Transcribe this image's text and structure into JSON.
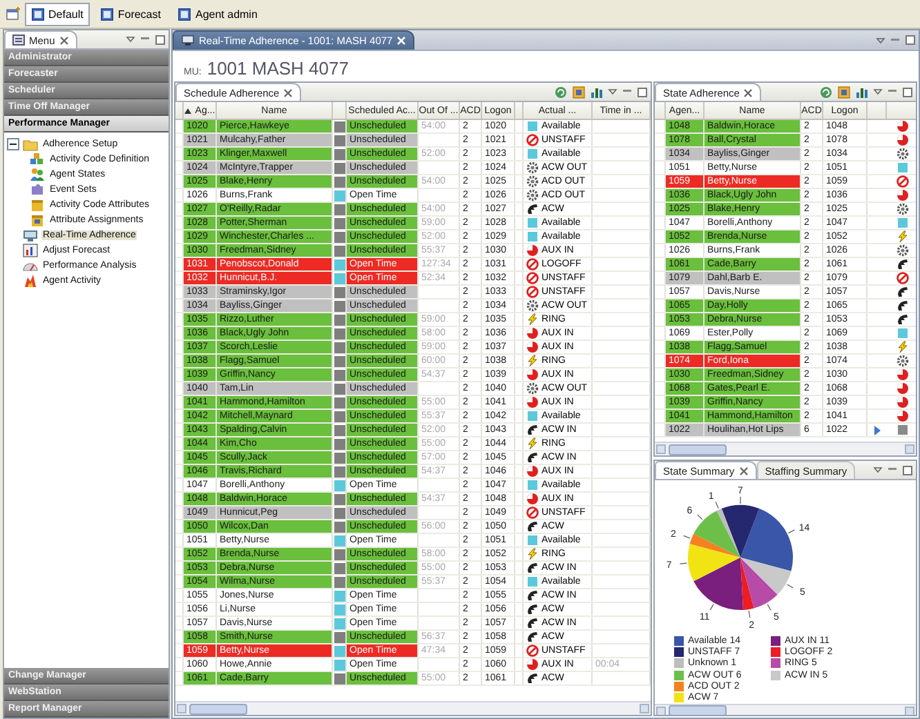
{
  "toolbar": {
    "perspectives": [
      {
        "label": "Default",
        "selected": true
      },
      {
        "label": "Forecast",
        "selected": false
      },
      {
        "label": "Agent admin",
        "selected": false
      }
    ]
  },
  "menu": {
    "title": "Menu",
    "sections_top": [
      {
        "label": "Administrator",
        "expanded": false
      },
      {
        "label": "Forecaster",
        "expanded": false
      },
      {
        "label": "Scheduler",
        "expanded": false
      },
      {
        "label": "Time Off Manager",
        "expanded": false
      },
      {
        "label": "Performance Manager",
        "expanded": true
      }
    ],
    "tree": [
      {
        "label": "Adherence Setup",
        "expanded": true,
        "selected": false,
        "children": [
          {
            "label": "Activity Code Definition",
            "selected": false
          },
          {
            "label": "Agent States",
            "selected": false
          },
          {
            "label": "Event Sets",
            "selected": false
          },
          {
            "label": "Activity Code Attributes",
            "selected": false
          },
          {
            "label": "Attribute Assignments",
            "selected": false
          }
        ]
      },
      {
        "label": "Real-Time Adherence",
        "selected": true
      },
      {
        "label": "Adjust Forecast",
        "selected": false
      },
      {
        "label": "Performance Analysis",
        "selected": false
      },
      {
        "label": "Agent Activity",
        "selected": false
      }
    ],
    "sections_bottom": [
      {
        "label": "Change Manager",
        "expanded": false
      },
      {
        "label": "WebStation",
        "expanded": false
      },
      {
        "label": "Report Manager",
        "expanded": false
      }
    ]
  },
  "editor": {
    "tab": "Real-Time Adherence - 1001: MASH 4077",
    "mu_label": "MU:",
    "mu_value": "1001 MASH 4077"
  },
  "schedule_adherence": {
    "title": "Schedule Adherence",
    "columns": [
      {
        "label": "Ag...",
        "sorted": true
      },
      {
        "label": "Name",
        "sorted": false
      },
      {
        "label": "Scheduled Ac...",
        "sorted": false
      },
      {
        "label": "Out Of ...",
        "sorted": false
      },
      {
        "label": "ACD",
        "sorted": false
      },
      {
        "label": "Logon",
        "sorted": false
      },
      {
        "label": "Actual ...",
        "sorted": false
      },
      {
        "label": "Time in ...",
        "sorted": false
      }
    ],
    "rows": [
      {
        "agent": "1020",
        "name": "Pierce,Hawkeye",
        "color": "#6abf3c",
        "swatch": {
          "color": "#7f7f7f"
        },
        "activity": "Unscheduled",
        "out_of": "54:00",
        "acd": "2",
        "logon": "1020",
        "state": {
          "kind": "available",
          "label": "Available"
        }
      },
      {
        "agent": "1021",
        "name": "Mulcahy,Father",
        "color": "#c0c0c0",
        "swatch": {
          "color": "#7f7f7f"
        },
        "activity": "Unscheduled",
        "acd": "2",
        "logon": "1021",
        "state": {
          "kind": "no_entry",
          "label": "UNSTAFF"
        }
      },
      {
        "agent": "1023",
        "name": "Klinger,Maxwell",
        "color": "#6abf3c",
        "swatch": {
          "color": "#7f7f7f"
        },
        "activity": "Unscheduled",
        "out_of": "52:00",
        "acd": "2",
        "logon": "1023",
        "state": {
          "kind": "available",
          "label": "Available"
        }
      },
      {
        "agent": "1024",
        "name": "McIntyre,Trapper",
        "color": "#c0c0c0",
        "swatch": {
          "color": "#7f7f7f"
        },
        "activity": "Unscheduled",
        "acd": "2",
        "logon": "1024",
        "state": {
          "kind": "gear",
          "label": "ACW OUT"
        }
      },
      {
        "agent": "1025",
        "name": "Blake,Henry",
        "color": "#6abf3c",
        "swatch": {
          "color": "#7f7f7f"
        },
        "activity": "Unscheduled",
        "out_of": "54:00",
        "acd": "2",
        "logon": "1025",
        "state": {
          "kind": "gear",
          "label": "ACD OUT"
        }
      },
      {
        "agent": "1026",
        "name": "Burns,Frank",
        "color": "#ffffff",
        "swatch": {
          "color": "#5cc8dc"
        },
        "activity": "Open Time",
        "acd": "2",
        "logon": "1026",
        "state": {
          "kind": "gear",
          "label": "ACD OUT"
        }
      },
      {
        "agent": "1027",
        "name": "O'Reilly,Radar",
        "color": "#6abf3c",
        "swatch": {
          "color": "#7f7f7f"
        },
        "activity": "Unscheduled",
        "out_of": "54:00",
        "acd": "2",
        "logon": "1027",
        "state": {
          "kind": "hand",
          "label": "ACW"
        }
      },
      {
        "agent": "1028",
        "name": "Potter,Sherman",
        "color": "#6abf3c",
        "swatch": {
          "color": "#7f7f7f"
        },
        "activity": "Unscheduled",
        "out_of": "59:00",
        "acd": "2",
        "logon": "1028",
        "state": {
          "kind": "available",
          "label": "Available"
        }
      },
      {
        "agent": "1029",
        "name": "Winchester,Charles ...",
        "color": "#6abf3c",
        "swatch": {
          "color": "#7f7f7f"
        },
        "activity": "Unscheduled",
        "out_of": "52:00",
        "acd": "2",
        "logon": "1029",
        "state": {
          "kind": "available",
          "label": "Available"
        }
      },
      {
        "agent": "1030",
        "name": "Freedman,Sidney",
        "color": "#6abf3c",
        "swatch": {
          "color": "#7f7f7f"
        },
        "activity": "Unscheduled",
        "out_of": "55:37",
        "acd": "2",
        "logon": "1030",
        "state": {
          "kind": "pie",
          "label": "AUX IN"
        }
      },
      {
        "agent": "1031",
        "name": "Penobscot,Donald",
        "color": "#ee2a24",
        "swatch": {
          "color": "#5cc8dc"
        },
        "activity": "Open Time",
        "out_of": "127:34",
        "acd": "2",
        "logon": "1031",
        "state": {
          "kind": "no_entry",
          "label": "LOGOFF"
        }
      },
      {
        "agent": "1032",
        "name": "Hunnicut,B.J.",
        "color": "#ee2a24",
        "swatch": {
          "color": "#5cc8dc"
        },
        "activity": "Open Time",
        "out_of": "52:34",
        "acd": "2",
        "logon": "1032",
        "state": {
          "kind": "no_entry",
          "label": "UNSTAFF"
        }
      },
      {
        "agent": "1033",
        "name": "Straminsky,Igor",
        "color": "#c0c0c0",
        "swatch": {
          "color": "#7f7f7f"
        },
        "activity": "Unscheduled",
        "acd": "2",
        "logon": "1033",
        "state": {
          "kind": "no_entry",
          "label": "UNSTAFF"
        }
      },
      {
        "agent": "1034",
        "name": "Bayliss,Ginger",
        "color": "#c0c0c0",
        "swatch": {
          "color": "#7f7f7f"
        },
        "activity": "Unscheduled",
        "acd": "2",
        "logon": "1034",
        "state": {
          "kind": "gear",
          "label": "ACW OUT"
        }
      },
      {
        "agent": "1035",
        "name": "Rizzo,Luther",
        "color": "#6abf3c",
        "swatch": {
          "color": "#7f7f7f"
        },
        "activity": "Unscheduled",
        "out_of": "59:00",
        "acd": "2",
        "logon": "1035",
        "state": {
          "kind": "lightning",
          "label": "RING"
        }
      },
      {
        "agent": "1036",
        "name": "Black,Ugly John",
        "color": "#6abf3c",
        "swatch": {
          "color": "#7f7f7f"
        },
        "activity": "Unscheduled",
        "out_of": "58:00",
        "acd": "2",
        "logon": "1036",
        "state": {
          "kind": "pie",
          "label": "AUX IN"
        }
      },
      {
        "agent": "1037",
        "name": "Scorch,Leslie",
        "color": "#6abf3c",
        "swatch": {
          "color": "#7f7f7f"
        },
        "activity": "Unscheduled",
        "out_of": "59:00",
        "acd": "2",
        "logon": "1037",
        "state": {
          "kind": "pie",
          "label": "AUX IN"
        }
      },
      {
        "agent": "1038",
        "name": "Flagg,Samuel",
        "color": "#6abf3c",
        "swatch": {
          "color": "#7f7f7f"
        },
        "activity": "Unscheduled",
        "out_of": "60:00",
        "acd": "2",
        "logon": "1038",
        "state": {
          "kind": "lightning",
          "label": "RING"
        }
      },
      {
        "agent": "1039",
        "name": "Griffin,Nancy",
        "color": "#6abf3c",
        "swatch": {
          "color": "#7f7f7f"
        },
        "activity": "Unscheduled",
        "out_of": "54:37",
        "acd": "2",
        "logon": "1039",
        "state": {
          "kind": "pie",
          "label": "AUX IN"
        }
      },
      {
        "agent": "1040",
        "name": "Tam,Lin",
        "color": "#c0c0c0",
        "swatch": {
          "color": "#7f7f7f"
        },
        "activity": "Unscheduled",
        "acd": "2",
        "logon": "1040",
        "state": {
          "kind": "gear",
          "label": "ACW OUT"
        }
      },
      {
        "agent": "1041",
        "name": "Hammond,Hamilton",
        "color": "#6abf3c",
        "swatch": {
          "color": "#7f7f7f"
        },
        "activity": "Unscheduled",
        "out_of": "55:00",
        "acd": "2",
        "logon": "1041",
        "state": {
          "kind": "pie",
          "label": "AUX IN"
        }
      },
      {
        "agent": "1042",
        "name": "Mitchell,Maynard",
        "color": "#6abf3c",
        "swatch": {
          "color": "#7f7f7f"
        },
        "activity": "Unscheduled",
        "out_of": "55:37",
        "acd": "2",
        "logon": "1042",
        "state": {
          "kind": "available",
          "label": "Available"
        }
      },
      {
        "agent": "1043",
        "name": "Spalding,Calvin",
        "color": "#6abf3c",
        "swatch": {
          "color": "#7f7f7f"
        },
        "activity": "Unscheduled",
        "out_of": "52:00",
        "acd": "2",
        "logon": "1043",
        "state": {
          "kind": "hand",
          "label": "ACW IN"
        }
      },
      {
        "agent": "1044",
        "name": "Kim,Cho",
        "color": "#6abf3c",
        "swatch": {
          "color": "#7f7f7f"
        },
        "activity": "Unscheduled",
        "out_of": "55:00",
        "acd": "2",
        "logon": "1044",
        "state": {
          "kind": "lightning",
          "label": "RING"
        }
      },
      {
        "agent": "1045",
        "name": "Scully,Jack",
        "color": "#6abf3c",
        "swatch": {
          "color": "#7f7f7f"
        },
        "activity": "Unscheduled",
        "out_of": "57:00",
        "acd": "2",
        "logon": "1045",
        "state": {
          "kind": "hand",
          "label": "ACW IN"
        }
      },
      {
        "agent": "1046",
        "name": "Travis,Richard",
        "color": "#6abf3c",
        "swatch": {
          "color": "#7f7f7f"
        },
        "activity": "Unscheduled",
        "out_of": "54:37",
        "acd": "2",
        "logon": "1046",
        "state": {
          "kind": "pie",
          "label": "AUX IN"
        }
      },
      {
        "agent": "1047",
        "name": "Borelli,Anthony",
        "color": "#ffffff",
        "swatch": {
          "color": "#5cc8dc"
        },
        "activity": "Open Time",
        "acd": "2",
        "logon": "1047",
        "state": {
          "kind": "available",
          "label": "Available"
        }
      },
      {
        "agent": "1048",
        "name": "Baldwin,Horace",
        "color": "#6abf3c",
        "swatch": {
          "color": "#7f7f7f"
        },
        "activity": "Unscheduled",
        "out_of": "54:37",
        "acd": "2",
        "logon": "1048",
        "state": {
          "kind": "pie",
          "label": "AUX IN"
        }
      },
      {
        "agent": "1049",
        "name": "Hunnicut,Peg",
        "color": "#c0c0c0",
        "swatch": {
          "color": "#7f7f7f"
        },
        "activity": "Unscheduled",
        "acd": "2",
        "logon": "1049",
        "state": {
          "kind": "no_entry",
          "label": "UNSTAFF"
        }
      },
      {
        "agent": "1050",
        "name": "Wilcox,Dan",
        "color": "#6abf3c",
        "swatch": {
          "color": "#7f7f7f"
        },
        "activity": "Unscheduled",
        "out_of": "56:00",
        "acd": "2",
        "logon": "1050",
        "state": {
          "kind": "hand",
          "label": "ACW"
        }
      },
      {
        "agent": "1051",
        "name": "Betty,Nurse",
        "color": "#ffffff",
        "swatch": {
          "color": "#5cc8dc"
        },
        "activity": "Open Time",
        "acd": "2",
        "logon": "1051",
        "state": {
          "kind": "available",
          "label": "Available"
        }
      },
      {
        "agent": "1052",
        "name": "Brenda,Nurse",
        "color": "#6abf3c",
        "swatch": {
          "color": "#7f7f7f"
        },
        "activity": "Unscheduled",
        "out_of": "58:00",
        "acd": "2",
        "logon": "1052",
        "state": {
          "kind": "lightning",
          "label": "RING"
        }
      },
      {
        "agent": "1053",
        "name": "Debra,Nurse",
        "color": "#6abf3c",
        "swatch": {
          "color": "#7f7f7f"
        },
        "activity": "Unscheduled",
        "out_of": "55:00",
        "acd": "2",
        "logon": "1053",
        "state": {
          "kind": "hand",
          "label": "ACW IN"
        }
      },
      {
        "agent": "1054",
        "name": "Wilma,Nurse",
        "color": "#6abf3c",
        "swatch": {
          "color": "#7f7f7f"
        },
        "activity": "Unscheduled",
        "out_of": "55:37",
        "acd": "2",
        "logon": "1054",
        "state": {
          "kind": "available",
          "label": "Available"
        }
      },
      {
        "agent": "1055",
        "name": "Jones,Nurse",
        "color": "#ffffff",
        "swatch": {
          "color": "#5cc8dc"
        },
        "activity": "Open Time",
        "acd": "2",
        "logon": "1055",
        "state": {
          "kind": "hand",
          "label": "ACW IN"
        }
      },
      {
        "agent": "1056",
        "name": "Li,Nurse",
        "color": "#ffffff",
        "swatch": {
          "color": "#5cc8dc"
        },
        "activity": "Open Time",
        "acd": "2",
        "logon": "1056",
        "state": {
          "kind": "hand",
          "label": "ACW"
        }
      },
      {
        "agent": "1057",
        "name": "Davis,Nurse",
        "color": "#ffffff",
        "swatch": {
          "color": "#5cc8dc"
        },
        "activity": "Open Time",
        "acd": "2",
        "logon": "1057",
        "state": {
          "kind": "hand",
          "label": "ACW IN"
        }
      },
      {
        "agent": "1058",
        "name": "Smith,Nurse",
        "color": "#6abf3c",
        "swatch": {
          "color": "#7f7f7f"
        },
        "activity": "Unscheduled",
        "out_of": "56:37",
        "acd": "2",
        "logon": "1058",
        "state": {
          "kind": "hand",
          "label": "ACW"
        }
      },
      {
        "agent": "1059",
        "name": "Betty,Nurse",
        "color": "#ee2a24",
        "swatch": {
          "color": "#5cc8dc"
        },
        "activity": "Open Time",
        "out_of": "47:34",
        "acd": "2",
        "logon": "1059",
        "state": {
          "kind": "no_entry",
          "label": "UNSTAFF"
        }
      },
      {
        "agent": "1060",
        "name": "Howe,Annie",
        "color": "#ffffff",
        "swatch": {
          "color": "#5cc8dc"
        },
        "activity": "Open Time",
        "acd": "2",
        "logon": "1060",
        "state": {
          "kind": "pie",
          "label": "AUX IN"
        },
        "time_in": "00:04"
      },
      {
        "agent": "1061",
        "name": "Cade,Barry",
        "color": "#6abf3c",
        "swatch": {
          "color": "#7f7f7f"
        },
        "activity": "Unscheduled",
        "out_of": "55:00",
        "acd": "2",
        "logon": "1061",
        "state": {
          "kind": "hand",
          "label": "ACW"
        }
      }
    ]
  },
  "state_adherence": {
    "title": "State Adherence",
    "columns": [
      {
        "label": "Agen...",
        "sorted": false
      },
      {
        "label": "Name",
        "sorted": false
      },
      {
        "label": "ACD",
        "sorted": false
      },
      {
        "label": "Logon",
        "sorted": false
      }
    ],
    "rows": [
      {
        "agent": "1048",
        "name": "Baldwin,Horace",
        "color": "#6abf3c",
        "acd": "2",
        "logon": "1048",
        "state": {
          "kind": "pie"
        },
        "flagged": false
      },
      {
        "agent": "1078",
        "name": "Ball,Crystal",
        "color": "#6abf3c",
        "acd": "2",
        "logon": "1078",
        "state": {
          "kind": "pie"
        },
        "flagged": false
      },
      {
        "agent": "1034",
        "name": "Bayliss,Ginger",
        "color": "#c0c0c0",
        "acd": "2",
        "logon": "1034",
        "state": {
          "kind": "gear"
        },
        "flagged": false
      },
      {
        "agent": "1051",
        "name": "Betty,Nurse",
        "color": "#ffffff",
        "acd": "2",
        "logon": "1051",
        "state": {
          "kind": "available"
        },
        "flagged": false
      },
      {
        "agent": "1059",
        "name": "Betty,Nurse",
        "color": "#ee2a24",
        "acd": "2",
        "logon": "1059",
        "state": {
          "kind": "no_entry"
        },
        "flagged": false
      },
      {
        "agent": "1036",
        "name": "Black,Ugly John",
        "color": "#6abf3c",
        "acd": "2",
        "logon": "1036",
        "state": {
          "kind": "pie"
        },
        "flagged": false
      },
      {
        "agent": "1025",
        "name": "Blake,Henry",
        "color": "#6abf3c",
        "acd": "2",
        "logon": "1025",
        "state": {
          "kind": "gear"
        },
        "flagged": false
      },
      {
        "agent": "1047",
        "name": "Borelli,Anthony",
        "color": "#ffffff",
        "acd": "2",
        "logon": "1047",
        "state": {
          "kind": "available"
        },
        "flagged": false
      },
      {
        "agent": "1052",
        "name": "Brenda,Nurse",
        "color": "#6abf3c",
        "acd": "2",
        "logon": "1052",
        "state": {
          "kind": "lightning"
        },
        "flagged": false
      },
      {
        "agent": "1026",
        "name": "Burns,Frank",
        "color": "#ffffff",
        "acd": "2",
        "logon": "1026",
        "state": {
          "kind": "gear"
        },
        "flagged": false
      },
      {
        "agent": "1061",
        "name": "Cade,Barry",
        "color": "#6abf3c",
        "acd": "2",
        "logon": "1061",
        "state": {
          "kind": "hand"
        },
        "flagged": false
      },
      {
        "agent": "1079",
        "name": "Dahl,Barb E.",
        "color": "#c0c0c0",
        "acd": "2",
        "logon": "1079",
        "state": {
          "kind": "no_entry"
        },
        "flagged": false
      },
      {
        "agent": "1057",
        "name": "Davis,Nurse",
        "color": "#ffffff",
        "acd": "2",
        "logon": "1057",
        "state": {
          "kind": "hand"
        },
        "flagged": false
      },
      {
        "agent": "1065",
        "name": "Day,Holly",
        "color": "#6abf3c",
        "acd": "2",
        "logon": "1065",
        "state": {
          "kind": "hand"
        },
        "flagged": false
      },
      {
        "agent": "1053",
        "name": "Debra,Nurse",
        "color": "#6abf3c",
        "acd": "2",
        "logon": "1053",
        "state": {
          "kind": "hand"
        },
        "flagged": false
      },
      {
        "agent": "1069",
        "name": "Ester,Polly",
        "color": "#ffffff",
        "acd": "2",
        "logon": "1069",
        "state": {
          "kind": "available"
        },
        "flagged": false
      },
      {
        "agent": "1038",
        "name": "Flagg,Samuel",
        "color": "#6abf3c",
        "acd": "2",
        "logon": "1038",
        "state": {
          "kind": "lightning"
        },
        "flagged": false
      },
      {
        "agent": "1074",
        "name": "Ford,Iona",
        "color": "#ee2a24",
        "acd": "2",
        "logon": "1074",
        "state": {
          "kind": "gear"
        },
        "flagged": false
      },
      {
        "agent": "1030",
        "name": "Freedman,Sidney",
        "color": "#6abf3c",
        "acd": "2",
        "logon": "1030",
        "state": {
          "kind": "pie"
        },
        "flagged": false
      },
      {
        "agent": "1068",
        "name": "Gates,Pearl E.",
        "color": "#6abf3c",
        "acd": "2",
        "logon": "1068",
        "state": {
          "kind": "pie"
        },
        "flagged": false
      },
      {
        "agent": "1039",
        "name": "Griffin,Nancy",
        "color": "#6abf3c",
        "acd": "2",
        "logon": "1039",
        "state": {
          "kind": "pie"
        },
        "flagged": false
      },
      {
        "agent": "1041",
        "name": "Hammond,Hamilton",
        "color": "#6abf3c",
        "acd": "2",
        "logon": "1041",
        "state": {
          "kind": "pie"
        },
        "flagged": false
      },
      {
        "agent": "1022",
        "name": "Houlihan,Hot Lips",
        "color": "#c0c0c0",
        "acd": "6",
        "logon": "1022",
        "state": {
          "kind": "unknown"
        },
        "flagged": true
      }
    ]
  },
  "summary": {
    "tabs": [
      {
        "label": "State Summary",
        "selected": true
      },
      {
        "label": "Staffing Summary",
        "selected": false
      }
    ],
    "chart_data": {
      "type": "pie",
      "values": [
        14,
        7,
        1,
        6,
        2,
        7,
        11,
        2,
        5,
        5
      ],
      "data_labels": true
    },
    "legend": [
      {
        "label": "Available 14",
        "color": "#3a56a8"
      },
      {
        "label": "UNSTAFF 7",
        "color": "#25286e"
      },
      {
        "label": "Unknown 1",
        "color": "#bdbdbd"
      },
      {
        "label": "ACW OUT 6",
        "color": "#6cc04a"
      },
      {
        "label": "ACD OUT 2",
        "color": "#f58220"
      },
      {
        "label": "ACW 7",
        "color": "#f2e414"
      },
      {
        "label": "AUX IN 11",
        "color": "#7a1f7e"
      },
      {
        "label": "LOGOFF 2",
        "color": "#ee1c24"
      },
      {
        "label": "RING 5",
        "color": "#b84aa8"
      },
      {
        "label": "ACW IN 5",
        "color": "#c9c9c9"
      }
    ]
  }
}
